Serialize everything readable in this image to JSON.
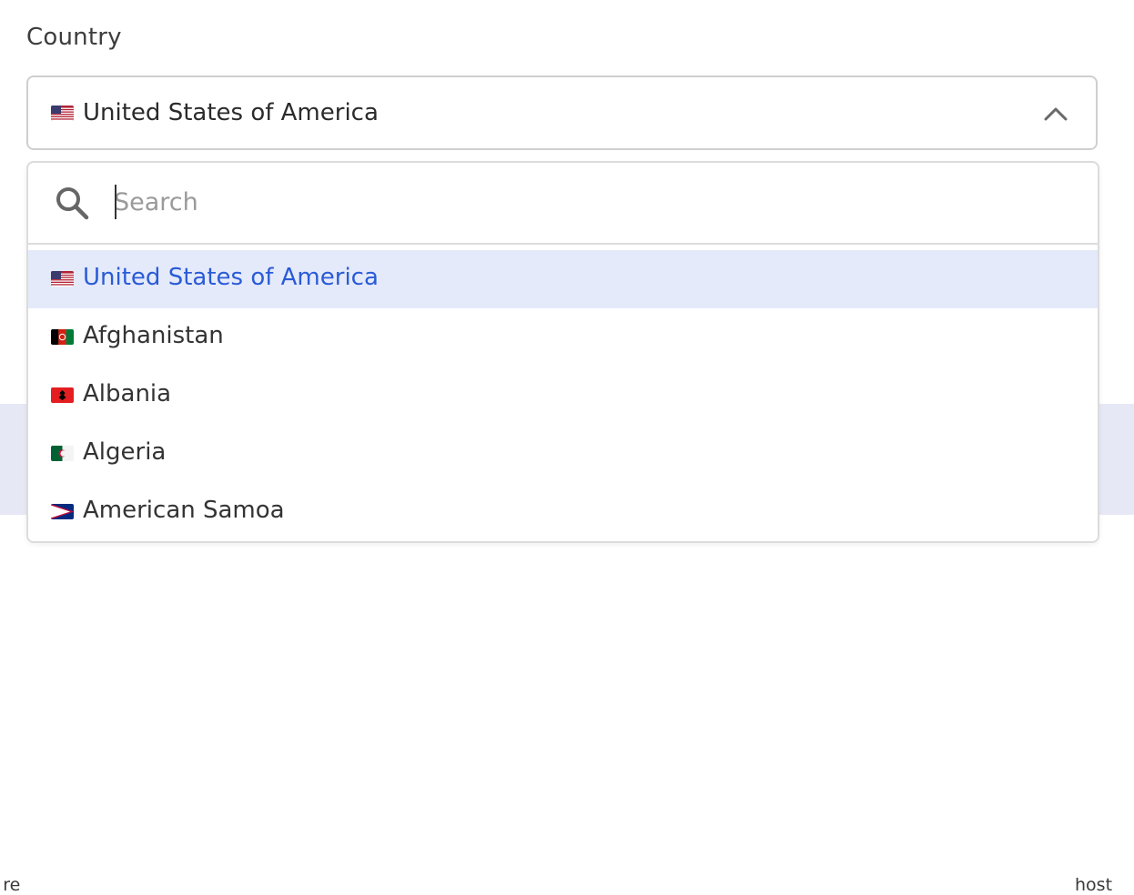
{
  "background": {
    "left_fragment": "y re",
    "right_fragment": "host"
  },
  "field": {
    "label": "Country",
    "selected_value": "United States of America",
    "selected_flag": "us-flag",
    "chevron": "chevron-up-icon"
  },
  "dropdown": {
    "search_placeholder": "Search",
    "search_value": "",
    "options": [
      {
        "label": "United States of America",
        "flag": "us-flag",
        "selected": true
      },
      {
        "label": "Afghanistan",
        "flag": "af-flag",
        "selected": false
      },
      {
        "label": "Albania",
        "flag": "al-flag",
        "selected": false
      },
      {
        "label": "Algeria",
        "flag": "dz-flag",
        "selected": false
      },
      {
        "label": "American Samoa",
        "flag": "as-flag",
        "selected": false
      }
    ]
  },
  "colors": {
    "selected_bg": "#e4eafa",
    "selected_text": "#2a5bd7",
    "border": "#cfcfcf",
    "band": "#e6e9f5"
  }
}
